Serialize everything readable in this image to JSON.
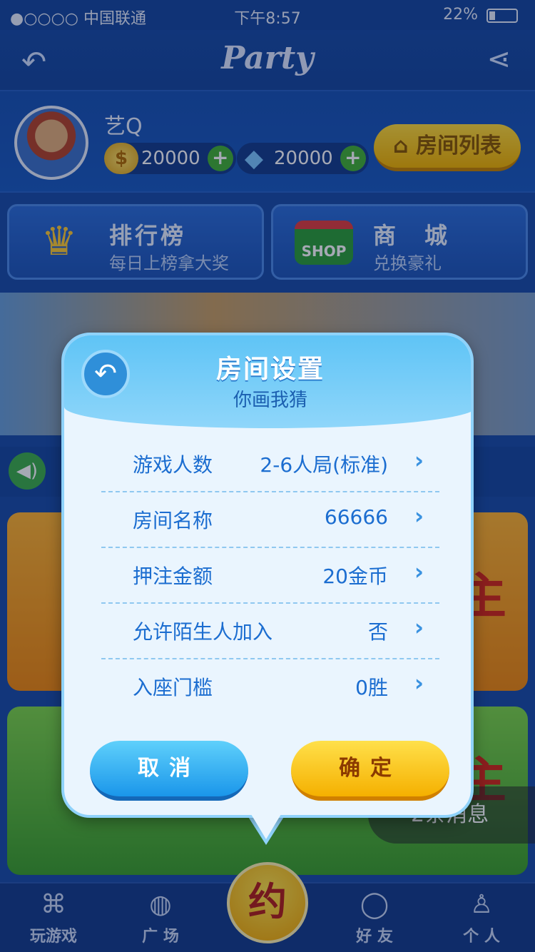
{
  "status_bar": {
    "carrier": "●○○○○ 中国联通",
    "time": "下午8:57",
    "battery": "22%"
  },
  "nav": {
    "back_icon": "undo-arrow-icon",
    "title": "Party",
    "share_icon": "share-icon"
  },
  "profile": {
    "nickname": "艺Q",
    "coins": "20000",
    "gems": "20000",
    "room_list_label": "房间列表"
  },
  "promos": [
    {
      "title": "排行榜",
      "subtitle": "每日上榜拿大奖",
      "icon": "crown-icon"
    },
    {
      "title": "商　城",
      "subtitle": "兑换豪礼",
      "icon": "shop-icon",
      "icon_text": "SHOP"
    }
  ],
  "cards": {
    "card1_text": "主",
    "card2_text": "主"
  },
  "message_pill": "2条消息",
  "tabs": [
    {
      "label": "玩游戏",
      "icon": "gamepad-icon"
    },
    {
      "label": "广 场",
      "icon": "planet-icon"
    },
    {
      "label": "好 友",
      "icon": "chat-bubble-icon"
    },
    {
      "label": "个 人",
      "icon": "person-icon"
    }
  ],
  "center_button": "约",
  "dialog": {
    "title": "房间设置",
    "subtitle": "你画我猜",
    "rows": [
      {
        "label": "游戏人数",
        "value": "2-6人局(标准)"
      },
      {
        "label": "房间名称",
        "value": "66666"
      },
      {
        "label": "押注金额",
        "value": "20金币"
      },
      {
        "label": "允许陌生人加入",
        "value": "否"
      },
      {
        "label": "入座门槛",
        "value": "0胜"
      }
    ],
    "cancel_label": "取消",
    "confirm_label": "确定"
  }
}
